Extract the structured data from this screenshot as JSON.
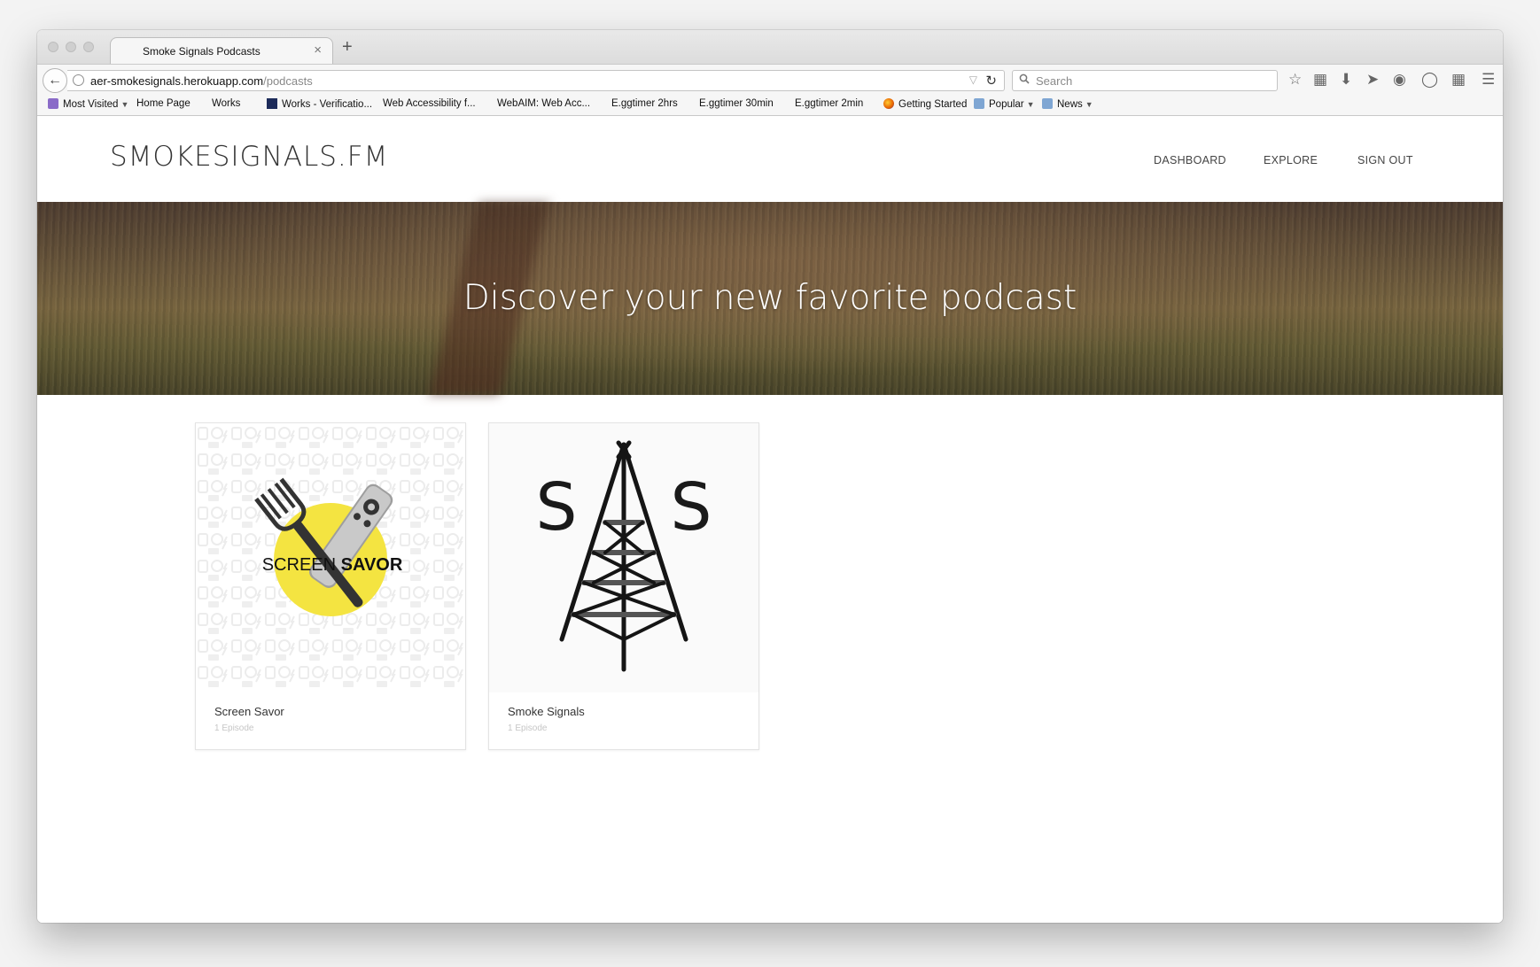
{
  "browser": {
    "tab_title": "Smoke Signals Podcasts",
    "tab_close": "×",
    "new_tab": "+",
    "url_host": "aer-smokesignals.herokuapp.com",
    "url_path": "/podcasts",
    "search_placeholder": "Search",
    "bookmarks": [
      {
        "label": "Most Visited",
        "icon": "most-visited-icon",
        "caret": true
      },
      {
        "label": "Home Page",
        "icon": "page-icon"
      },
      {
        "label": "Works",
        "icon": "page-icon"
      },
      {
        "label": "Works - Verificatio...",
        "icon": "works-icon"
      },
      {
        "label": "Web Accessibility f...",
        "icon": "page-icon"
      },
      {
        "label": "WebAIM: Web Acc...",
        "icon": "page-icon"
      },
      {
        "label": "E.ggtimer 2hrs",
        "icon": "page-icon"
      },
      {
        "label": "E.ggtimer 30min",
        "icon": "page-icon"
      },
      {
        "label": "E.ggtimer 2min",
        "icon": "page-icon"
      },
      {
        "label": "Getting Started",
        "icon": "firefox-icon"
      },
      {
        "label": "Popular",
        "icon": "folder-icon",
        "caret": true
      },
      {
        "label": "News",
        "icon": "folder-icon",
        "caret": true
      }
    ]
  },
  "site": {
    "logo": "SMOKESIGNALS.FM",
    "nav": {
      "dashboard": "DASHBOARD",
      "explore": "EXPLORE",
      "sign_out": "SIGN OUT"
    },
    "hero_title": "Discover your new favorite podcast"
  },
  "podcasts": [
    {
      "title": "Screen Savor",
      "episodes": "1 Episode",
      "art_text_1": "SCREEN",
      "art_text_2": "SAVOR"
    },
    {
      "title": "Smoke Signals",
      "episodes": "1 Episode",
      "art_text_1": "S",
      "art_text_2": "S"
    }
  ],
  "colors": {
    "accent_yellow": "#f4e441",
    "text_dark": "#333333",
    "muted": "#c6c6c6"
  }
}
